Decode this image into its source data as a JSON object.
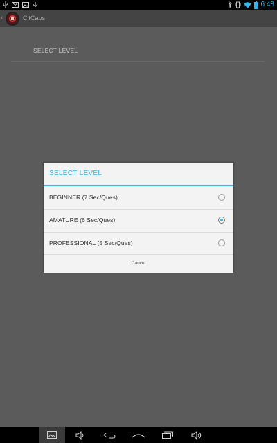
{
  "status_bar": {
    "time": "6:48",
    "left_icons": [
      "usb-icon",
      "mail-icon",
      "image-icon",
      "download-icon"
    ],
    "right_icons": [
      "bluetooth-icon",
      "vibrate-icon",
      "wifi-icon",
      "battery-icon"
    ],
    "time_color": "#33b5e5"
  },
  "action_bar": {
    "title": "CitCaps",
    "background": "#444444"
  },
  "settings": {
    "select_level_label": "SELECT LEVEL"
  },
  "dialog": {
    "title": "SELECT LEVEL",
    "accent_color": "#33b5e5",
    "options": [
      {
        "label": "BEGINNER (7 Sec/Ques)",
        "selected": false
      },
      {
        "label": "AMATURE (6 Sec/Ques)",
        "selected": true
      },
      {
        "label": "PROFESSIONAL (5 Sec/Ques)",
        "selected": false
      }
    ],
    "cancel_label": "Cancel"
  },
  "nav_bar": {
    "buttons": [
      "screenshot-icon",
      "volume-down-icon",
      "back-icon",
      "home-icon",
      "recent-apps-icon",
      "volume-up-icon"
    ]
  }
}
